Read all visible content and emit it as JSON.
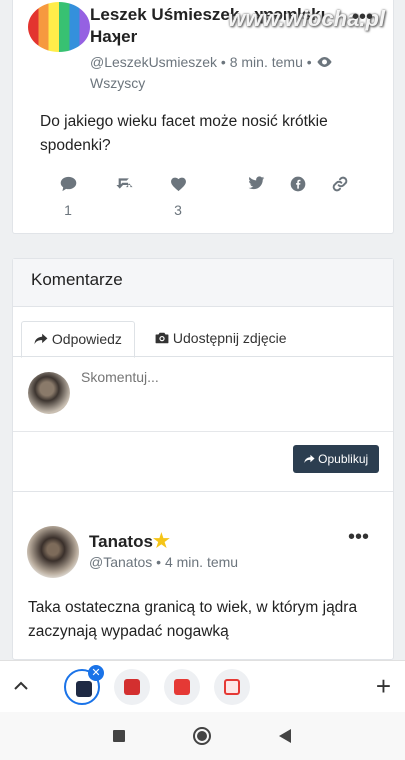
{
  "post": {
    "author_name": "Leszek Uśmieszek - ʞɐǝıɐlskı Haʞer",
    "handle": "@LeszekUsmieszek",
    "time": "8 min. temu",
    "visibility": "Wszyscy",
    "text": "Do jakiego wieku facet może nosić krótkie spodenki?",
    "comment_count": "1",
    "like_count": "3",
    "watermark": "www.wiocha.pl"
  },
  "comments_section": {
    "header": "Komentarze",
    "tabs": [
      {
        "label": "Odpowiedz"
      },
      {
        "label": "Udostępnij zdjęcie"
      }
    ],
    "input_placeholder": "Skomentuj...",
    "publish_label": "Opublikuj"
  },
  "comment": {
    "author": "Tanatos",
    "handle": "@Tanatos",
    "time": "4 min. temu",
    "text": "Taka ostateczna granicą to wiek, w którym jądra zaczynają wypadać nogawką"
  },
  "browser": {
    "tabs": [
      {
        "name": "active-tab",
        "color": "#1f2a44"
      },
      {
        "name": "tab-2",
        "color": "#d32f2f"
      },
      {
        "name": "tab-3",
        "color": "#e53935"
      },
      {
        "name": "tab-4",
        "color": "#e53935"
      }
    ]
  },
  "colors": {
    "publish_button": "#2c3e50",
    "accent": "#1a73e8"
  }
}
